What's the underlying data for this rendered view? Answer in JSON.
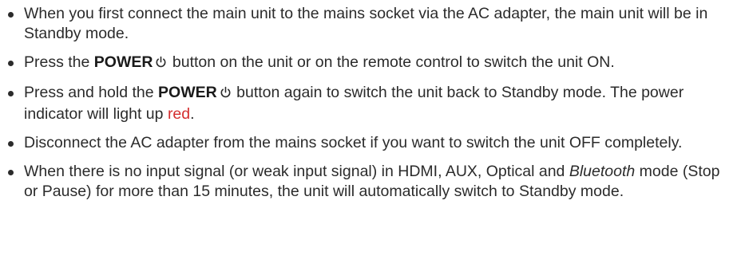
{
  "colors": {
    "text": "#2b2b2b",
    "accent_red": "#d42e2e"
  },
  "icons": {
    "power": "power-symbol-icon"
  },
  "bullets": [
    {
      "text": "When you first connect the main unit to the mains socket via the AC adapter, the main unit will be in Standby mode."
    },
    {
      "before": "Press the",
      "bold": "POWER",
      "after": "button on the unit or on the remote control to switch the unit ON."
    },
    {
      "before": "Press and hold the",
      "bold": "POWER",
      "after": "button again to switch the unit back to Standby mode. The power indicator will light up",
      "highlight": "red",
      "end": "."
    },
    {
      "text": "Disconnect the AC adapter from the mains socket if you want to switch the unit OFF completely."
    },
    {
      "before": "When there is no input signal (or weak input signal) in HDMI, AUX, Optical and",
      "italic": "Bluetooth",
      "after": "mode (Stop or Pause) for more than 15 minutes, the unit will automatically switch to Standby mode."
    }
  ]
}
